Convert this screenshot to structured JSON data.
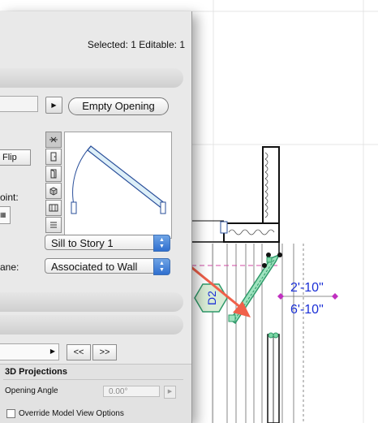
{
  "status": {
    "selection": "Selected: 1 Editable: 1"
  },
  "toolbar": {
    "arrow_glyph": "▶",
    "empty_opening_label": "Empty Opening"
  },
  "geometry": {
    "flip_label": "Flip",
    "anchor_label_fragment": "oint:"
  },
  "anchor": {
    "selector": "Sill to Story 1"
  },
  "plane": {
    "label_fragment": "ane:",
    "selector": "Associated to Wall"
  },
  "navigation": {
    "prev_label": "<<",
    "next_label": ">>"
  },
  "projections": {
    "title": "3D Projections",
    "opening_angle_label": "Opening Angle",
    "opening_angle_value": "0.00°",
    "override_label": "Override Model View Options"
  },
  "plan": {
    "tag_label": "D2",
    "dim_width": "2'-10\"",
    "dim_height": "6'-10\""
  },
  "colors": {
    "panel_bg": "#e9e9e9",
    "accent_blue": "#1a2fd6",
    "door_green": "#2f9a6a",
    "tag_fill": "#d9ecd6",
    "arrow_red": "#f0604a",
    "marker_magenta": "#c02fc0",
    "select_blue": "#2f6fcf"
  },
  "icons": {
    "tool_icons": [
      "plan-view-icon",
      "door-icon",
      "opening-icon",
      "box-3d-icon",
      "frame-icon",
      "list-icon"
    ]
  }
}
